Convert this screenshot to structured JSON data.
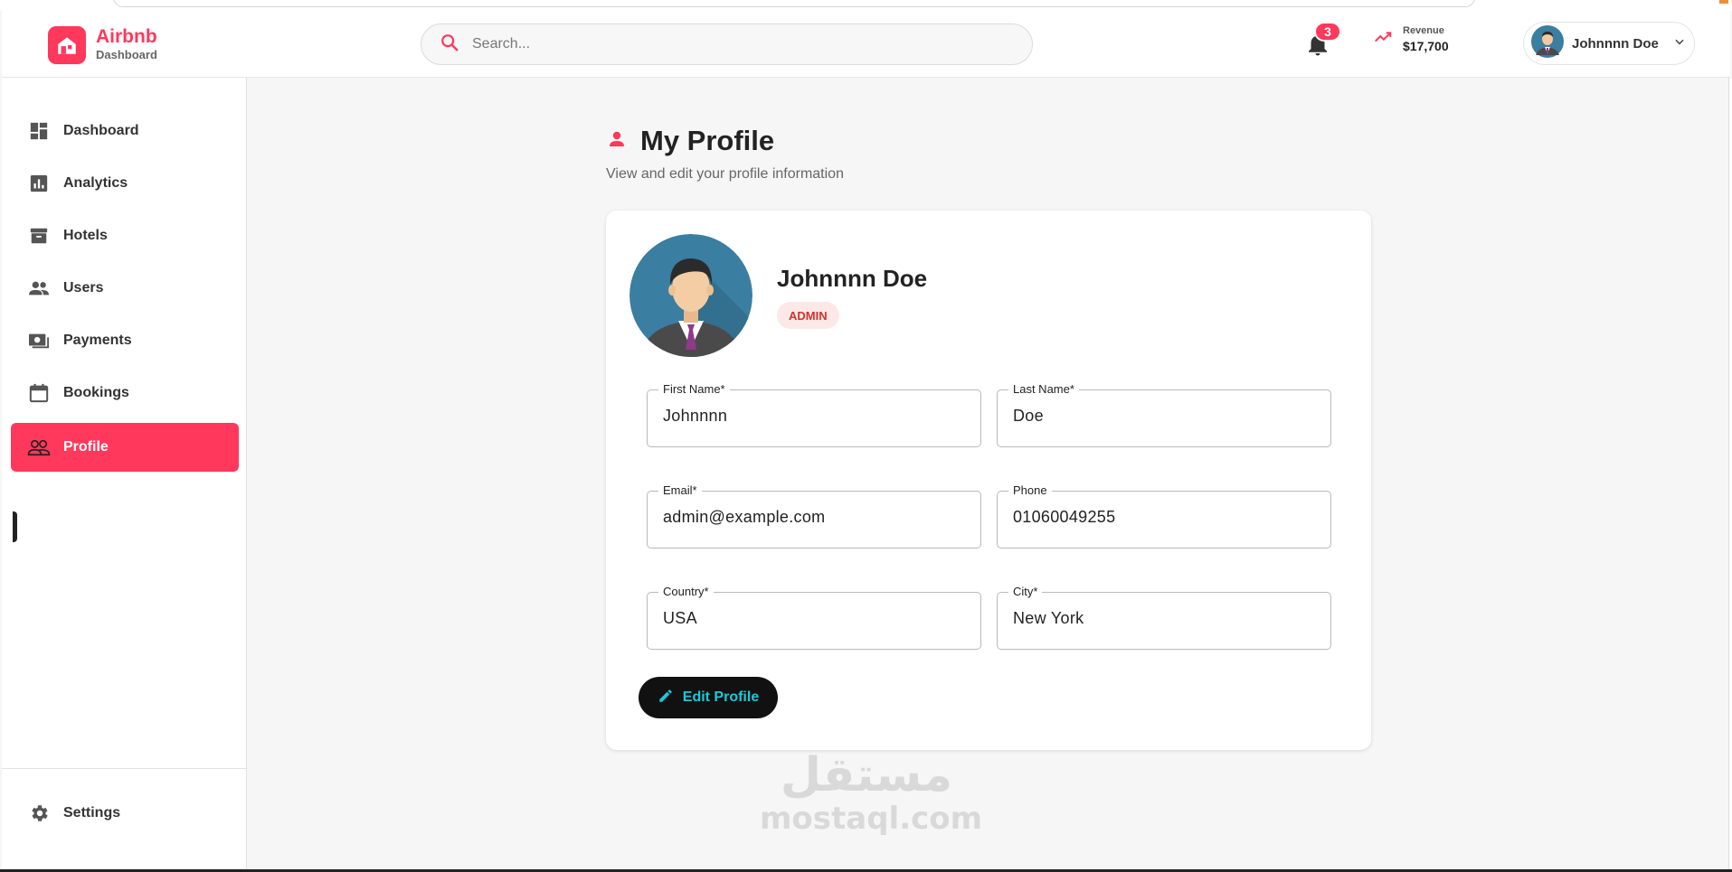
{
  "header": {
    "brand_name": "Airbnb",
    "brand_sub": "Dashboard",
    "search_placeholder": "Search...",
    "notifications_count": "3",
    "revenue_label": "Revenue",
    "revenue_value": "$17,700",
    "user_name": "Johnnnn Doe"
  },
  "sidebar": {
    "items": [
      {
        "label": "Dashboard",
        "icon": "dashboard-icon"
      },
      {
        "label": "Analytics",
        "icon": "analytics-icon"
      },
      {
        "label": "Hotels",
        "icon": "archive-icon"
      },
      {
        "label": "Users",
        "icon": "users-icon"
      },
      {
        "label": "Payments",
        "icon": "payments-icon"
      },
      {
        "label": "Bookings",
        "icon": "calendar-icon"
      },
      {
        "label": "Profile",
        "icon": "people-outline-icon",
        "active": true
      }
    ],
    "settings_label": "Settings"
  },
  "page": {
    "title": "My Profile",
    "subtitle": "View and edit your profile information"
  },
  "profile": {
    "full_name": "Johnnnn Doe",
    "role": "ADMIN",
    "fields": {
      "first_name": {
        "label": "First Name*",
        "value": "Johnnnn"
      },
      "last_name": {
        "label": "Last Name*",
        "value": "Doe"
      },
      "email": {
        "label": "Email*",
        "value": "admin@example.com"
      },
      "phone": {
        "label": "Phone",
        "value": "01060049255"
      },
      "country": {
        "label": "Country*",
        "value": "USA"
      },
      "city": {
        "label": "City*",
        "value": "New York"
      }
    },
    "edit_button_label": "Edit Profile"
  },
  "watermark": {
    "arabic": "مستقل",
    "latin": "mostaql.com"
  },
  "colors": {
    "accent": "#ff385c",
    "button_bg": "#111111",
    "button_text": "#1cc8d8",
    "role_badge_bg": "#fde8e8",
    "role_badge_text": "#d0342c"
  }
}
